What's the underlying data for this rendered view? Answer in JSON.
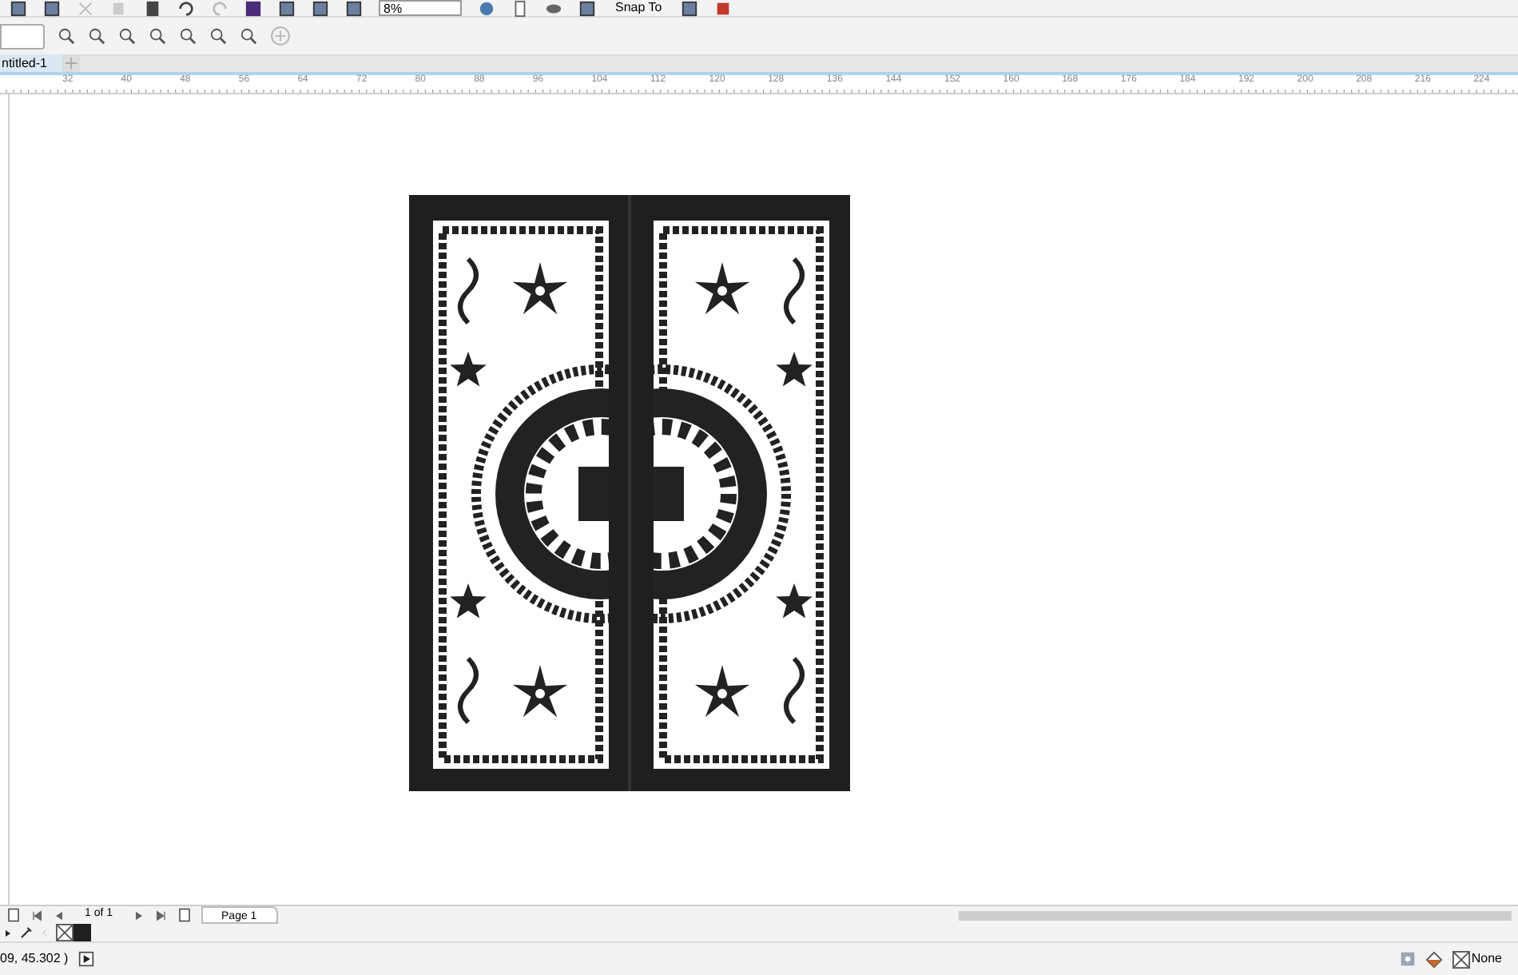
{
  "toolbar": {
    "zoom": "8%",
    "snap": "Snap To"
  },
  "document_tabs": [
    {
      "label": "ntitled-1",
      "selected": true
    }
  ],
  "ruler": {
    "labels": [
      "32",
      "40",
      "48",
      "56",
      "64",
      "72",
      "80",
      "88",
      "96",
      "104",
      "112",
      "120",
      "128",
      "136",
      "144",
      "152",
      "160",
      "168",
      "176",
      "184",
      "192",
      "200",
      "208",
      "216",
      "224"
    ]
  },
  "page_nav": {
    "counter": "1 of 1",
    "pages": [
      {
        "label": "Page 1",
        "selected": true
      }
    ]
  },
  "status_bar": {
    "coordinates": "09, 45.302 )",
    "fill": "None"
  }
}
